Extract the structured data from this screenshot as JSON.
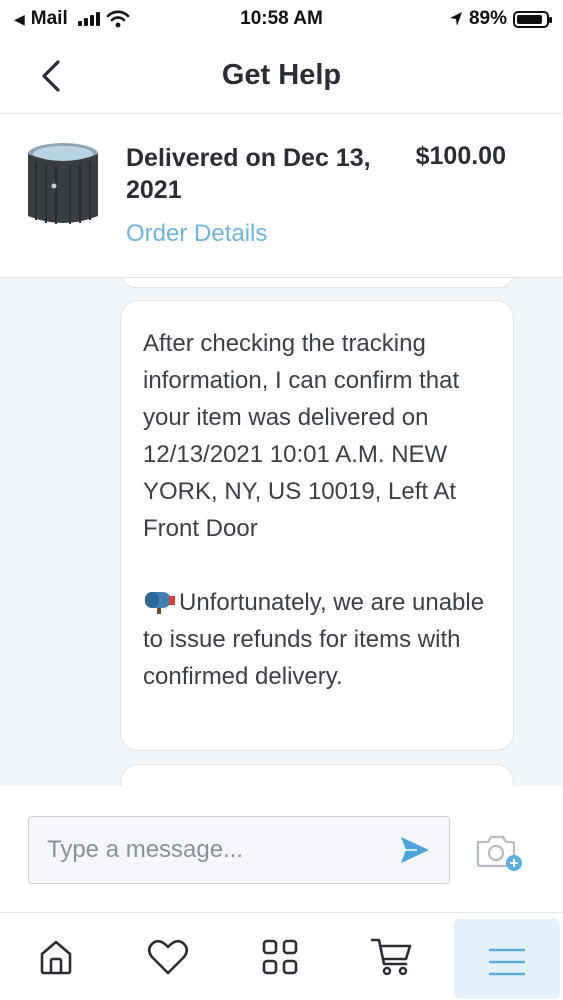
{
  "status_bar": {
    "back_app": "Mail",
    "time": "10:58 AM",
    "battery": "89%",
    "battery_level": 0.89
  },
  "header": {
    "title": "Get Help"
  },
  "order": {
    "status": "Delivered on Dec 13, 2021",
    "price": "$100.00",
    "details_link": "Order Details"
  },
  "chat": {
    "messages": [
      "After checking the tracking information, I can confirm that your item was delivered on 12/13/2021 10:01 A.M. NEW YORK, NY, US 10019, Left At Front Door",
      "Unfortunately, we are unable to issue refunds for items with confirmed delivery."
    ],
    "mailbox_icon": "mailbox-icon"
  },
  "composer": {
    "placeholder": "Type a message..."
  },
  "colors": {
    "accent": "#6fb5dc",
    "send": "#4aa6db",
    "chat_bg": "#f2f5f8",
    "text": "#2a2d33"
  },
  "bottom_nav": {
    "items": [
      "home-icon",
      "heart-icon",
      "categories-icon",
      "cart-icon",
      "menu-icon"
    ]
  }
}
